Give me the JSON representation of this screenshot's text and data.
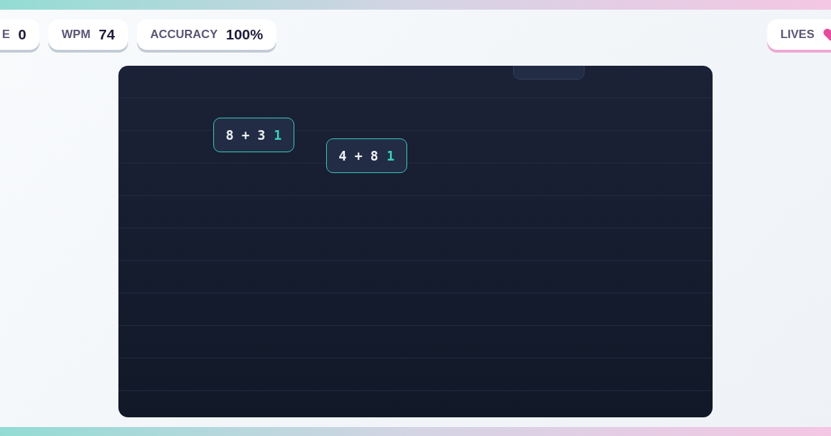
{
  "stats": [
    {
      "kind": "stat",
      "label": "E",
      "value": "0"
    },
    {
      "kind": "stat",
      "label": "WPM",
      "value": "74"
    },
    {
      "kind": "stat",
      "label": "ACCURACY",
      "value": "100%"
    }
  ],
  "lives": {
    "label": "LIVES"
  },
  "tiles": [
    {
      "kind": "cut"
    },
    {
      "kind": "word",
      "text": "8 + 3",
      "typed": "1",
      "active": true
    },
    {
      "kind": "word",
      "text": "4 + 8",
      "typed": "1",
      "active": true
    }
  ]
}
